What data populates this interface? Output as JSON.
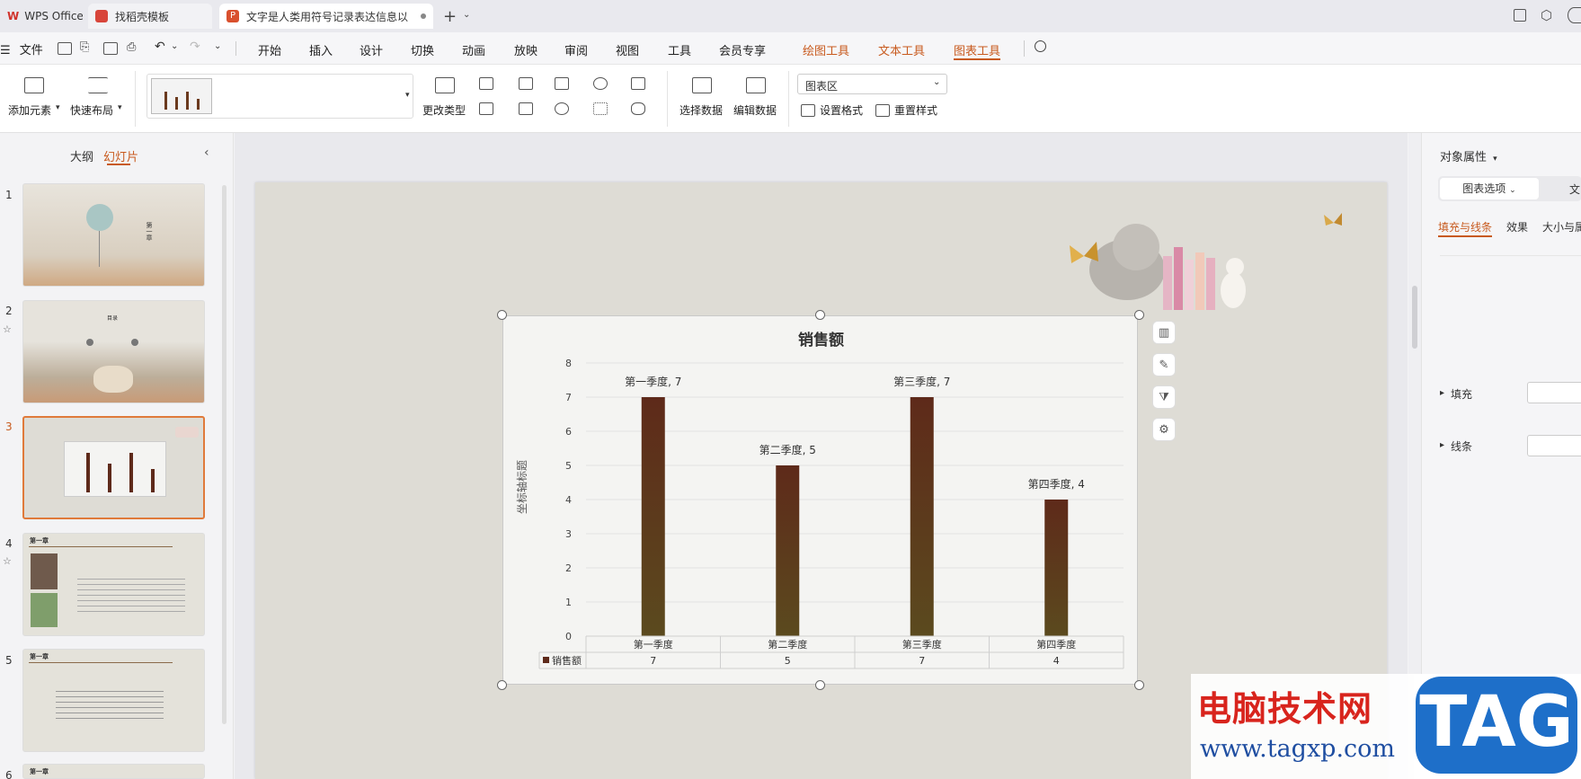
{
  "tabs": {
    "wps": "WPS Office",
    "template": "找稻壳模板",
    "doc": "文字是人类用符号记录表达信息以"
  },
  "menu": {
    "file": "文件",
    "items": [
      "开始",
      "插入",
      "设计",
      "切换",
      "动画",
      "放映",
      "审阅",
      "视图",
      "工具",
      "会员专享"
    ],
    "context": [
      "绘图工具",
      "文本工具",
      "图表工具"
    ]
  },
  "ribbon": {
    "add_element": "添加元素",
    "quick_layout": "快速布局",
    "change_type": "更改类型",
    "select_data": "选择数据",
    "edit_data": "编辑数据",
    "chart_area": "图表区",
    "set_format": "设置格式",
    "reset_style": "重置样式"
  },
  "left_panel": {
    "outline": "大纲",
    "slides": "幻灯片",
    "slide_numbers": [
      "1",
      "2",
      "3",
      "4",
      "5",
      "6"
    ],
    "thumb1_title": "第一章",
    "thumb2_title": "目录",
    "thumb4_title": "第一章",
    "thumb5_title": "第一章",
    "thumb6_title": "第一章"
  },
  "right_panel": {
    "title": "对象属性",
    "tab_chart_options": "图表选项",
    "tab_text": "文",
    "sub_fill_line": "填充与线条",
    "sub_effect": "效果",
    "sub_size": "大小与属",
    "fill": "填充",
    "line": "线条"
  },
  "chart_data": {
    "type": "bar",
    "title": "销售额",
    "ylabel": "坐标轴标题",
    "xlabel": "",
    "categories": [
      "第一季度",
      "第二季度",
      "第三季度",
      "第四季度"
    ],
    "series": [
      {
        "name": "销售额",
        "values": [
          7,
          5,
          7,
          4
        ]
      }
    ],
    "data_labels": [
      "第一季度, 7",
      "第二季度, 5",
      "第三季度, 7",
      "第四季度, 4"
    ],
    "ylim": [
      0,
      8
    ],
    "yticks": [
      "0",
      "1",
      "2",
      "3",
      "4",
      "5",
      "6",
      "7",
      "8"
    ],
    "grid": true,
    "data_table": true,
    "bar_color_top": "#5e2a1a",
    "bar_color_bottom": "#5b4a1e"
  },
  "watermark": {
    "text": "电脑技术网",
    "url": "www.tagxp.com",
    "tag": "TAG"
  },
  "colors": {
    "accent": "#c85a1e",
    "selected_border": "#e07a3a"
  }
}
